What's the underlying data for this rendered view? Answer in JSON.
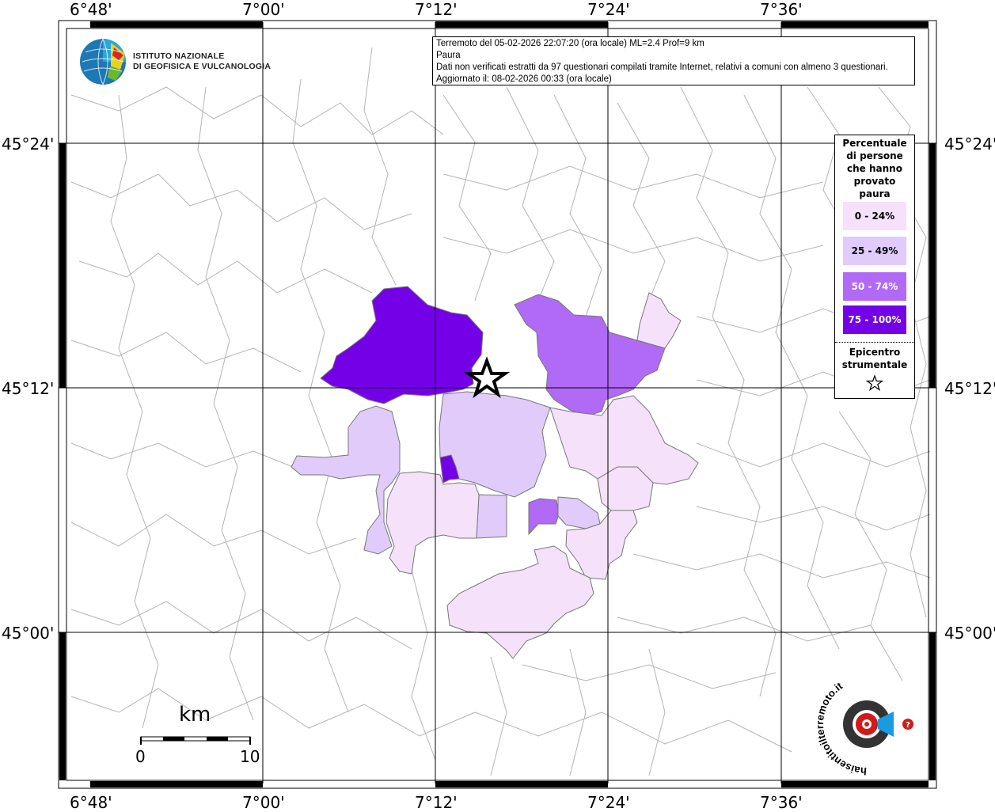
{
  "map": {
    "longitude_labels": [
      "6°48'",
      "7°00'",
      "7°12'",
      "7°24'",
      "7°36'"
    ],
    "latitude_labels": [
      "45°24'",
      "45°12'",
      "45°00'"
    ]
  },
  "info": {
    "line1": "Terremoto del 05-02-2026 22:07:20 (ora locale) ML=2.4 Prof=9 km",
    "line2": "Paura",
    "line3": "Dati non verificati estratti da 97 questionari compilati tramite Internet, relativi a comuni con almeno 3 questionari.",
    "line4": "Aggiornato il: 08-02-2026 00:33 (ora locale)"
  },
  "logo": {
    "line1": "ISTITUTO NAZIONALE",
    "line2": "DI GEOFISICA E VULCANOLOGIA"
  },
  "legend": {
    "title": [
      "Percentuale",
      "di persone",
      "che hanno",
      "provato",
      "paura"
    ],
    "classes": [
      {
        "label": "0 - 24%",
        "color": "#f5e1fa",
        "text_color": "#000000"
      },
      {
        "label": "25 - 49%",
        "color": "#e0cbfa",
        "text_color": "#000000"
      },
      {
        "label": "50 - 74%",
        "color": "#b06af5",
        "text_color": "#ffffff"
      },
      {
        "label": "75 - 100%",
        "color": "#7400e8",
        "text_color": "#ffffff"
      }
    ],
    "epicenter": [
      "Epicentro",
      "strumentale"
    ]
  },
  "scale": {
    "unit": "km",
    "min": "0",
    "max": "10"
  },
  "badge": {
    "text": "haisentitoilterremoto.it",
    "url": "www."
  }
}
